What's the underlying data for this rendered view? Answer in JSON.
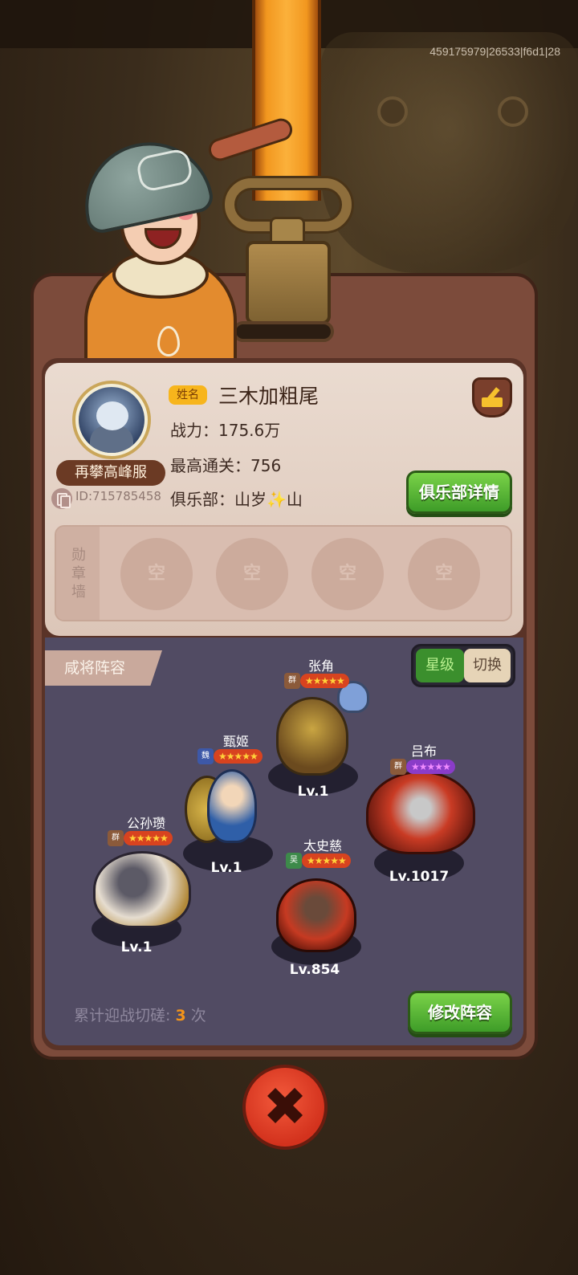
{
  "build_id": "459175979|26533|f6d1|28",
  "profile": {
    "server": "再攀高峰服",
    "id_text": "ID:715785458",
    "name_tag": "姓名",
    "name": "三木加粗尾",
    "power": "战力：175.6万",
    "highest_stage": "最高通关：756",
    "club": "俱乐部：山岁✨山",
    "club_details_label": "俱乐部详情"
  },
  "badge_wall": {
    "label": "勋章墙",
    "slots": [
      "空",
      "空",
      "空",
      "空"
    ]
  },
  "lineup": {
    "tab_label": "咸将阵容",
    "toggle": {
      "active": "星级",
      "inactive": "切换"
    },
    "units": [
      {
        "name": "张角",
        "faction": "群",
        "stars": "★★★★★",
        "level": "Lv.1"
      },
      {
        "name": "甄姬",
        "faction": "魏",
        "stars": "★★★★★",
        "level": "Lv.1"
      },
      {
        "name": "吕布",
        "faction": "群",
        "stars": "★★★★★",
        "level": "Lv.1017"
      },
      {
        "name": "公孙瓒",
        "faction": "群",
        "stars": "★★★★★",
        "level": "Lv.1"
      },
      {
        "name": "太史慈",
        "faction": "吴",
        "stars": "★★★★★",
        "level": "Lv.854"
      }
    ],
    "battle_count_prefix": "累计迎战切磋:",
    "battle_count": "3",
    "battle_count_suffix": "次",
    "modify_label": "修改阵容"
  },
  "close_symbol": "✖",
  "colors": {
    "accent_green": "#3e9c28",
    "count_orange": "#f3941a",
    "name_tag_yellow": "#f7b51c"
  }
}
